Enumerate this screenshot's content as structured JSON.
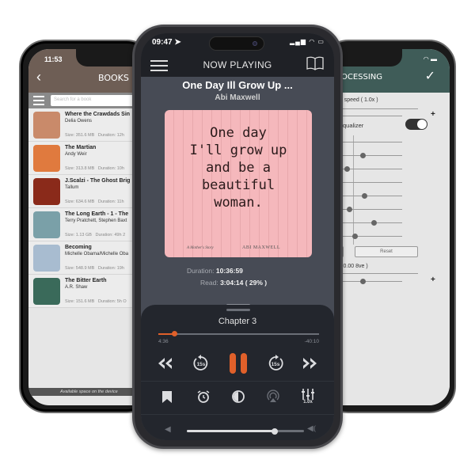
{
  "left_phone": {
    "status_time": "11:53",
    "header_title": "BOOKS",
    "search_placeholder": "Search for a book",
    "books": [
      {
        "title": "Where the Crawdads Sin",
        "author": "Delia Owens",
        "size": "Size: 351.6 MB",
        "duration": "Duration: 12h",
        "cover_color": "#c98a6a"
      },
      {
        "title": "The Martian",
        "author": "Andy Weir",
        "size": "Size: 313.8 MB",
        "duration": "Duration: 10h",
        "cover_color": "#e07a3e"
      },
      {
        "title": "J.Scalzi - The Ghost Brig",
        "author": "Tallum",
        "size": "Size: 634.6 MB",
        "duration": "Duration: 11h",
        "cover_color": "#8a2a1a"
      },
      {
        "title": "The Long Earth - 1 - The",
        "author": "Terry Pratchett, Stephen Baxt",
        "size": "Size: 1.13 GB",
        "duration": "Duration: 49h 2",
        "cover_color": "#7aa0a8"
      },
      {
        "title": "Becoming",
        "author": "Michelle Obama/Michelle Oba",
        "size": "Size: 548.9 MB",
        "duration": "Duration: 19h",
        "cover_color": "#a8bcd0"
      },
      {
        "title": "The Bitter Earth",
        "author": "A.R. Shaw",
        "size": "Size: 151.6 MB",
        "duration": "Duration: 5h O",
        "cover_color": "#3a6a5a"
      }
    ],
    "footer": "Available space on the device"
  },
  "right_phone": {
    "header_title": "PROCESSING",
    "playback_speed_label": "back speed ( 1.0x )",
    "equalizer_label": "Equalizer",
    "equalizer_on": true,
    "eq_bands": [
      0.15,
      0.5,
      0.3,
      0.2,
      0.52,
      0.33,
      0.64,
      0.4
    ],
    "reset_label": "Reset",
    "pitch_label": "tch ( 0.00 8ve )",
    "pitch_value": 0.5,
    "speed_value": 0.5
  },
  "center_phone": {
    "status_time": "09:47",
    "header_title": "NOW PLAYING",
    "book_title": "One Day Ill Grow Up ...",
    "book_author": "Abi Maxwell",
    "cover": {
      "text_lines": [
        "One day",
        "I'll grow up",
        "and be a",
        "beautiful",
        "woman."
      ],
      "subtitle": "A Mother's Story",
      "author": "ABI MAXWELL"
    },
    "duration_label": "Duration:",
    "duration_value": "10:36:59",
    "read_label": "Read:",
    "read_value": "3:04:14 ( 29% )",
    "chapter": "Chapter 3",
    "elapsed": "4:36",
    "remaining": "-40:10",
    "chapter_progress": 0.1,
    "volume": 0.75,
    "speed_badge": "1.0x",
    "rewind_seconds": "15s",
    "forward_seconds": "15s",
    "accent_color": "#e0602a"
  }
}
